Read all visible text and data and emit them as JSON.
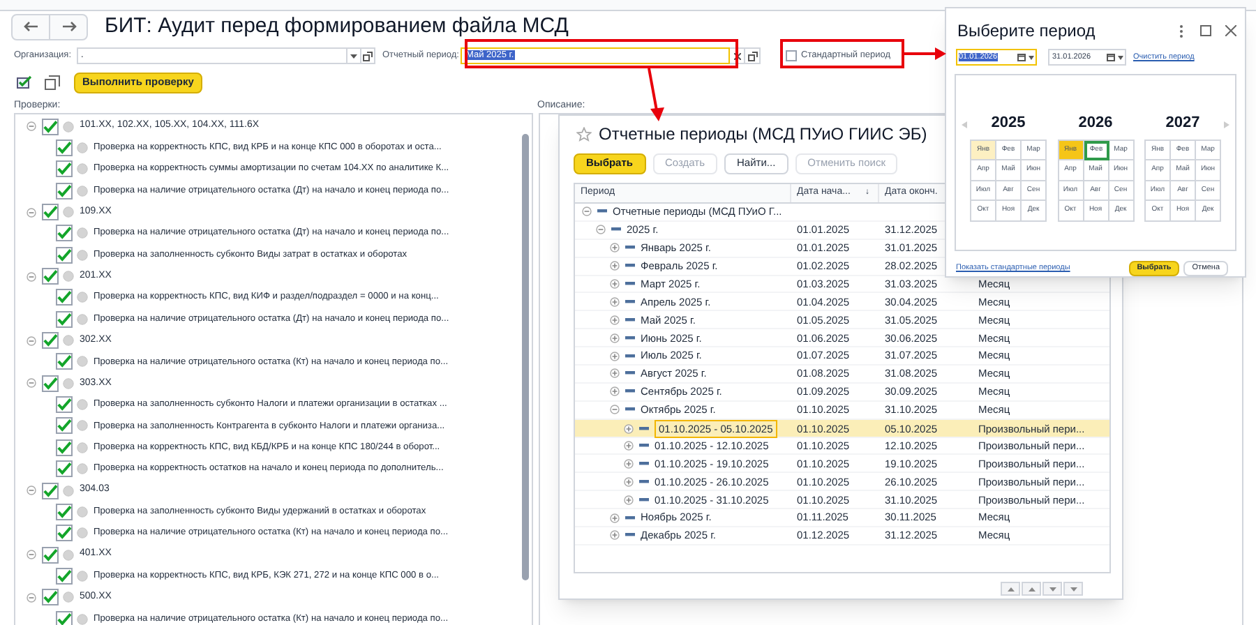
{
  "page": {
    "title": "БИТ: Аудит перед формированием файла МСД"
  },
  "filters": {
    "organization": {
      "label": "Организация:",
      "value": "."
    },
    "period": {
      "label": "Отчетный период:",
      "value": "Май 2025 г."
    },
    "standard_period": {
      "label": "Стандартный период",
      "checked": false
    }
  },
  "toolbar": {
    "run_button": "Выполнить проверку"
  },
  "checks": {
    "label": "Проверки:",
    "tree": [
      {
        "label": "101.XX, 102.XX, 105.XX, 104.XX, 111.6X",
        "checked": true,
        "expanded": true,
        "children": [
          {
            "label": "Проверка на корректность КПС, вид КРБ и на конце КПС 000 в оборотах и оста...",
            "checked": true
          },
          {
            "label": "Проверка на корректность суммы амортизации по счетам 104.XX по аналитике К...",
            "checked": true
          },
          {
            "label": "Проверка на наличие отрицательного остатка (Дт) на начало и конец периода по...",
            "checked": true
          }
        ]
      },
      {
        "label": "109.XX",
        "checked": true,
        "expanded": true,
        "children": [
          {
            "label": "Проверка на наличие отрицательного остатка (Дт) на начало и конец периода по...",
            "checked": true
          },
          {
            "label": "Проверка на заполненность субконто Виды затрат в остатках и оборотах",
            "checked": true
          }
        ]
      },
      {
        "label": "201.XX",
        "checked": true,
        "expanded": true,
        "children": [
          {
            "label": "Проверка на корректность КПС, вид КИФ и раздел/подраздел = 0000 и на конц...",
            "checked": true
          },
          {
            "label": "Проверка на наличие отрицательного остатка (Дт) на начало и конец периода по...",
            "checked": true
          }
        ]
      },
      {
        "label": "302.XX",
        "checked": true,
        "expanded": true,
        "children": [
          {
            "label": "Проверка на наличие отрицательного остатка (Кт) на начало и конец периода по...",
            "checked": true
          }
        ]
      },
      {
        "label": "303.XX",
        "checked": true,
        "expanded": true,
        "children": [
          {
            "label": "Проверка на заполненность субконто Налоги и платежи организации в остатках ...",
            "checked": true
          },
          {
            "label": "Проверка на заполненность Контрагента в субконто Налоги и платежи организа...",
            "checked": true
          },
          {
            "label": "Проверка на корректность КПС, вид КБД/КРБ и на конце КПС 180/244 в оборот...",
            "checked": true
          },
          {
            "label": "Проверка на корректность остатков на начало и конец периода по дополнитель...",
            "checked": true
          }
        ]
      },
      {
        "label": "304.03",
        "checked": true,
        "expanded": true,
        "children": [
          {
            "label": "Проверка на заполненность субконто Виды удержаний в остатках и оборотах",
            "checked": true
          },
          {
            "label": "Проверка на наличие отрицательного остатка (Кт) на начало и конец периода по...",
            "checked": true
          }
        ]
      },
      {
        "label": "401.XX",
        "checked": true,
        "expanded": true,
        "children": [
          {
            "label": "Проверка на корректность КПС, вид КРБ, КЭК 271, 272 и на конце КПС 000 в о...",
            "checked": true
          }
        ]
      },
      {
        "label": "500.XX",
        "checked": true,
        "expanded": true,
        "children": [
          {
            "label": "Проверка на наличие отрицательного остатка (Кт) на начало и конец периода по...",
            "checked": true
          }
        ]
      }
    ]
  },
  "description": {
    "label": "Описание:"
  },
  "periods_dialog": {
    "title": "Отчетные периоды (МСД ПУиО ГИИС ЭБ)",
    "buttons": [
      {
        "label": "Выбрать",
        "kind": "primary",
        "disabled": false
      },
      {
        "label": "Создать",
        "kind": "default",
        "disabled": true
      },
      {
        "label": "Найти...",
        "kind": "default",
        "disabled": false
      },
      {
        "label": "Отменить поиск",
        "kind": "default",
        "disabled": true
      }
    ],
    "columns": [
      {
        "label": "Период"
      },
      {
        "label": "Дата нача...",
        "sort_icon": "↓"
      },
      {
        "label": "Дата оконч."
      }
    ],
    "rows": [
      {
        "label": "Отчетные периоды (МСД ПУиО Г...",
        "expanded": true,
        "selected": false,
        "children": [
          {
            "label": "2025 г.",
            "start": "01.01.2025",
            "end": "31.12.2025",
            "expanded": true,
            "selected": false,
            "children": [
              {
                "label": "Январь 2025 г.",
                "start": "01.01.2025",
                "end": "31.01.2025",
                "expanded": false,
                "selected": false
              },
              {
                "label": "Февраль 2025 г.",
                "start": "01.02.2025",
                "end": "28.02.2025",
                "expanded": false,
                "selected": false
              },
              {
                "label": "Март 2025 г.",
                "start": "01.03.2025",
                "end": "31.03.2025",
                "column_4": "Месяц",
                "expanded": false,
                "selected": false
              },
              {
                "label": "Апрель 2025 г.",
                "start": "01.04.2025",
                "end": "30.04.2025",
                "column_4": "Месяц",
                "expanded": false,
                "selected": false
              },
              {
                "label": "Май 2025 г.",
                "start": "01.05.2025",
                "end": "31.05.2025",
                "column_4": "Месяц",
                "expanded": false,
                "selected": false
              },
              {
                "label": "Июнь 2025 г.",
                "start": "01.06.2025",
                "end": "30.06.2025",
                "column_4": "Месяц",
                "expanded": false,
                "selected": false
              },
              {
                "label": "Июль 2025 г.",
                "start": "01.07.2025",
                "end": "31.07.2025",
                "column_4": "Месяц",
                "expanded": false,
                "selected": false
              },
              {
                "label": "Август 2025 г.",
                "start": "01.08.2025",
                "end": "31.08.2025",
                "column_4": "Месяц",
                "expanded": false,
                "selected": false
              },
              {
                "label": "Сентябрь 2025 г.",
                "start": "01.09.2025",
                "end": "30.09.2025",
                "column_4": "Месяц",
                "expanded": false,
                "selected": false
              },
              {
                "label": "Октябрь 2025 г.",
                "start": "01.10.2025",
                "end": "31.10.2025",
                "column_4": "Месяц",
                "expanded": true,
                "selected": false,
                "children": [
                  {
                    "label": "01.10.2025 - 05.10.2025",
                    "start": "01.10.2025",
                    "end": "05.10.2025",
                    "column_4": "Произвольный пери...",
                    "expanded": false,
                    "selected": true
                  },
                  {
                    "label": "01.10.2025 - 12.10.2025",
                    "start": "01.10.2025",
                    "end": "12.10.2025",
                    "column_4": "Произвольный пери...",
                    "expanded": false,
                    "selected": false
                  },
                  {
                    "label": "01.10.2025 - 19.10.2025",
                    "start": "01.10.2025",
                    "end": "19.10.2025",
                    "column_4": "Произвольный пери...",
                    "expanded": false,
                    "selected": false
                  },
                  {
                    "label": "01.10.2025 - 26.10.2025",
                    "start": "01.10.2025",
                    "end": "26.10.2025",
                    "column_4": "Произвольный пери...",
                    "expanded": false,
                    "selected": false
                  },
                  {
                    "label": "01.10.2025 - 31.10.2025",
                    "start": "01.10.2025",
                    "end": "31.10.2025",
                    "column_4": "Произвольный пери...",
                    "expanded": false,
                    "selected": false
                  }
                ]
              },
              {
                "label": "Ноябрь 2025 г.",
                "start": "01.11.2025",
                "end": "30.11.2025",
                "column_4": "Месяц",
                "expanded": false,
                "selected": false
              },
              {
                "label": "Декабрь 2025 г.",
                "start": "01.12.2025",
                "end": "31.12.2025",
                "column_4": "Месяц",
                "expanded": false,
                "selected": false
              }
            ]
          }
        ]
      }
    ]
  },
  "period_picker": {
    "title": "Выберите период",
    "from": "01.01.2026",
    "to": "31.01.2026",
    "clear_link": "Очистить период",
    "years": [
      {
        "label": "2025",
        "months": [
          {
            "label": "Янв",
            "selected": false,
            "hovered": true,
            "focused": false
          },
          {
            "label": "Фев",
            "selected": false,
            "hovered": false,
            "focused": false
          },
          {
            "label": "Мар",
            "selected": false,
            "hovered": false,
            "focused": false
          },
          {
            "label": "Апр",
            "selected": false,
            "hovered": false,
            "focused": false
          },
          {
            "label": "Май",
            "selected": false,
            "hovered": false,
            "focused": false
          },
          {
            "label": "Июн",
            "selected": false,
            "hovered": false,
            "focused": false
          },
          {
            "label": "Июл",
            "selected": false,
            "hovered": false,
            "focused": false
          },
          {
            "label": "Авг",
            "selected": false,
            "hovered": false,
            "focused": false
          },
          {
            "label": "Сен",
            "selected": false,
            "hovered": false,
            "focused": false
          },
          {
            "label": "Окт",
            "selected": false,
            "hovered": false,
            "focused": false
          },
          {
            "label": "Ноя",
            "selected": false,
            "hovered": false,
            "focused": false
          },
          {
            "label": "Дек",
            "selected": false,
            "hovered": false,
            "focused": false
          }
        ]
      },
      {
        "label": "2026",
        "months": [
          {
            "label": "Янв",
            "selected": true,
            "hovered": false,
            "focused": false
          },
          {
            "label": "Фев",
            "selected": false,
            "hovered": false,
            "focused": true
          },
          {
            "label": "Мар",
            "selected": false,
            "hovered": false,
            "focused": false
          },
          {
            "label": "Апр",
            "selected": false,
            "hovered": false,
            "focused": false
          },
          {
            "label": "Май",
            "selected": false,
            "hovered": false,
            "focused": false
          },
          {
            "label": "Июн",
            "selected": false,
            "hovered": false,
            "focused": false
          },
          {
            "label": "Июл",
            "selected": false,
            "hovered": false,
            "focused": false
          },
          {
            "label": "Авг",
            "selected": false,
            "hovered": false,
            "focused": false
          },
          {
            "label": "Сен",
            "selected": false,
            "hovered": false,
            "focused": false
          },
          {
            "label": "Окт",
            "selected": false,
            "hovered": false,
            "focused": false
          },
          {
            "label": "Ноя",
            "selected": false,
            "hovered": false,
            "focused": false
          },
          {
            "label": "Дек",
            "selected": false,
            "hovered": false,
            "focused": false
          }
        ]
      },
      {
        "label": "2027",
        "months": [
          {
            "label": "Янв",
            "selected": false,
            "hovered": false,
            "focused": false
          },
          {
            "label": "Фев",
            "selected": false,
            "hovered": false,
            "focused": false
          },
          {
            "label": "Мар",
            "selected": false,
            "hovered": false,
            "focused": false
          },
          {
            "label": "Апр",
            "selected": false,
            "hovered": false,
            "focused": false
          },
          {
            "label": "Май",
            "selected": false,
            "hovered": false,
            "focused": false
          },
          {
            "label": "Июн",
            "selected": false,
            "hovered": false,
            "focused": false
          },
          {
            "label": "Июл",
            "selected": false,
            "hovered": false,
            "focused": false
          },
          {
            "label": "Авг",
            "selected": false,
            "hovered": false,
            "focused": false
          },
          {
            "label": "Сен",
            "selected": false,
            "hovered": false,
            "focused": false
          },
          {
            "label": "Окт",
            "selected": false,
            "hovered": false,
            "focused": false
          },
          {
            "label": "Ноя",
            "selected": false,
            "hovered": false,
            "focused": false
          },
          {
            "label": "Дек",
            "selected": false,
            "hovered": false,
            "focused": false
          }
        ]
      }
    ],
    "standard_link": "Показать стандартные периоды",
    "buttons": [
      {
        "label": "Выбрать",
        "kind": "primary"
      },
      {
        "label": "Отмена",
        "kind": "default"
      }
    ]
  }
}
